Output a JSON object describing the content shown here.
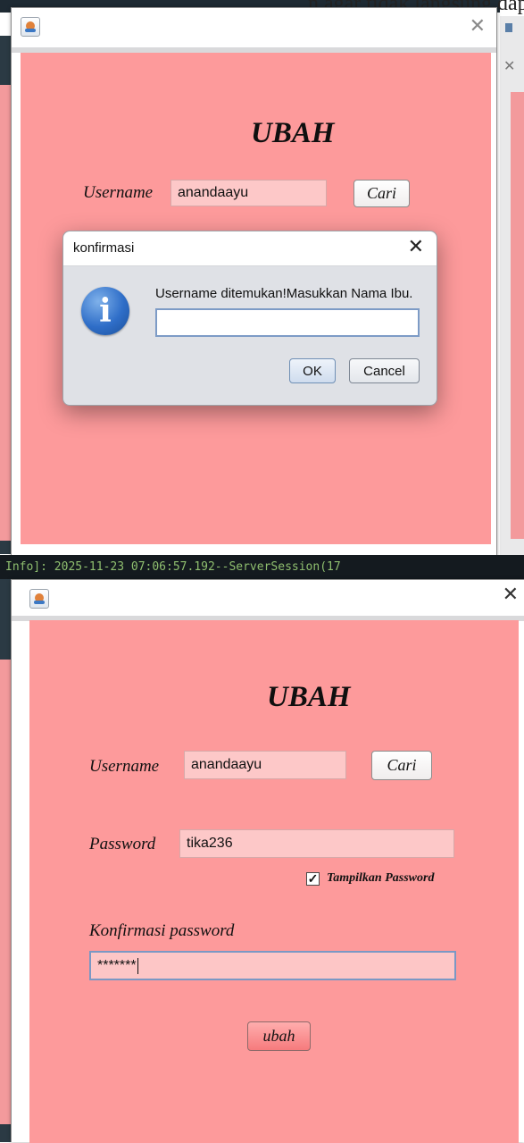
{
  "background": {
    "document_fragment": "n   agar tidak langsung dap",
    "terminal_line": "Info]: 2025-11-23 07:06:57.192--ServerSession(17"
  },
  "form_top": {
    "title": "UBAH",
    "username_label": "Username",
    "username_value": "anandaayu",
    "search_button": "Cari"
  },
  "dialog": {
    "title": "konfirmasi",
    "message": "Username ditemukan!Masukkan Nama Ibu.",
    "input_value": "",
    "ok_button": "OK",
    "cancel_button": "Cancel",
    "icon": "info-icon"
  },
  "form_bottom": {
    "title": "UBAH",
    "username_label": "Username",
    "username_value": "anandaayu",
    "search_button": "Cari",
    "password_label": "Password",
    "password_value": "tika236",
    "show_password_label": "Tampilkan Password",
    "show_password_checked": true,
    "confirm_label": "Konfirmasi password",
    "confirm_value": "*******",
    "submit_button": "ubah"
  },
  "colors": {
    "panel": "#fd9a9b",
    "field": "#fdc8c8",
    "submit_button": "#f67b7d",
    "focus_border": "#7a98c4"
  }
}
